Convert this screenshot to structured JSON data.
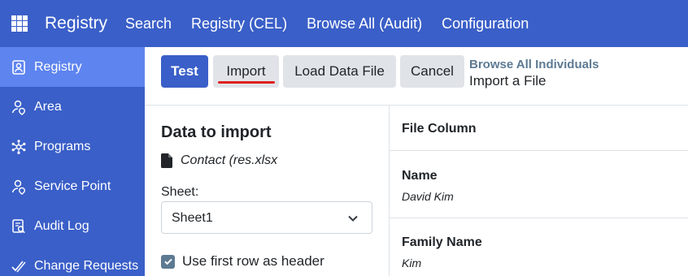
{
  "topbar": {
    "app_icon": "grid-icon",
    "brand": "Registry",
    "nav": [
      "Search",
      "Registry (CEL)",
      "Browse All (Audit)",
      "Configuration"
    ]
  },
  "sidebar": {
    "items": [
      {
        "label": "Registry",
        "icon": "person-badge-icon",
        "active": true
      },
      {
        "label": "Area",
        "icon": "person-pin-icon",
        "active": false
      },
      {
        "label": "Programs",
        "icon": "network-icon",
        "active": false
      },
      {
        "label": "Service Point",
        "icon": "person-pin-icon",
        "active": false
      },
      {
        "label": "Audit Log",
        "icon": "audit-log-icon",
        "active": false
      },
      {
        "label": "Change Requests",
        "icon": "check-request-icon",
        "active": false
      }
    ]
  },
  "toolbar": {
    "test_label": "Test",
    "import_label": "Import",
    "load_label": "Load Data File",
    "cancel_label": "Cancel"
  },
  "breadcrumb": {
    "parent": "Browse All Individuals",
    "current": "Import a File"
  },
  "left_panel": {
    "title": "Data to import",
    "file_icon": "file-icon",
    "file_name": "Contact (res.xlsx",
    "sheet_label": "Sheet:",
    "sheet_value": "Sheet1",
    "header_checkbox_label": "Use first row as header",
    "header_checkbox_checked": true
  },
  "right_panel": {
    "column_header": "File Column",
    "fields": [
      {
        "name": "Name",
        "value": "David Kim"
      },
      {
        "name": "Family Name",
        "value": "Kim"
      }
    ]
  },
  "colors": {
    "primary": "#3a5fc8",
    "sidebar_active": "#5e84ef",
    "muted_link": "#5d7a93",
    "annotation_underline": "#e02020"
  }
}
